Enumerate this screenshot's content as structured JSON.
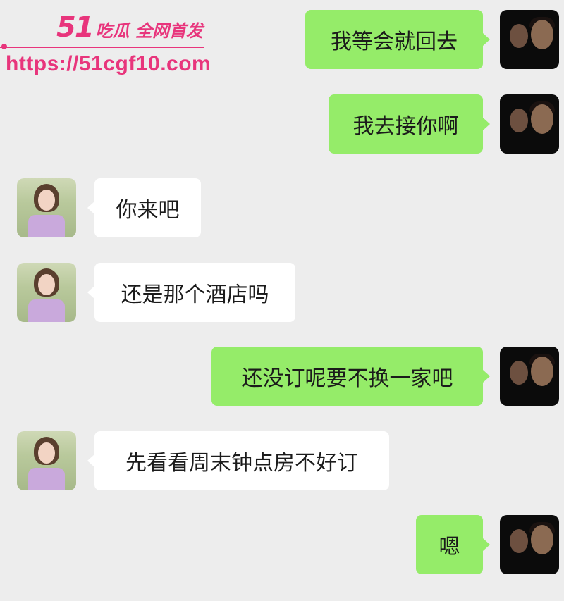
{
  "watermark": {
    "brand_number": "51",
    "brand_tag": "吃瓜 全网首发",
    "url": "https://51cgf10.com"
  },
  "messages": [
    {
      "sender": "me",
      "text": "我等会就回去"
    },
    {
      "sender": "me",
      "text": "我去接你啊"
    },
    {
      "sender": "them",
      "text": "你来吧"
    },
    {
      "sender": "them",
      "text": "还是那个酒店吗"
    },
    {
      "sender": "me",
      "text": "还没订呢要不换一家吧"
    },
    {
      "sender": "them",
      "text": "先看看周末钟点房不好订"
    },
    {
      "sender": "me",
      "text": "嗯"
    }
  ],
  "colors": {
    "background": "#ededed",
    "sent_bubble": "#95ec69",
    "received_bubble": "#ffffff",
    "watermark": "#e8357c"
  }
}
